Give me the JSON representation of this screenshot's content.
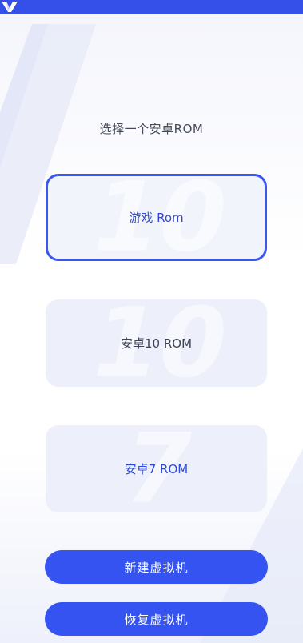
{
  "app": {
    "logo_icon": "v-logo-icon",
    "accent_color": "#3553f0"
  },
  "main": {
    "title": "选择一个安卓ROM",
    "rom_options": [
      {
        "label": "游戏 Rom",
        "bg_numeral": "10",
        "selected": true
      },
      {
        "label": "安卓10 ROM",
        "bg_numeral": "10",
        "selected": false
      },
      {
        "label": "安卓7 ROM",
        "bg_numeral": "7",
        "selected": false
      }
    ],
    "create_button": "新建虚拟机",
    "restore_button": "恢复虚拟机"
  }
}
